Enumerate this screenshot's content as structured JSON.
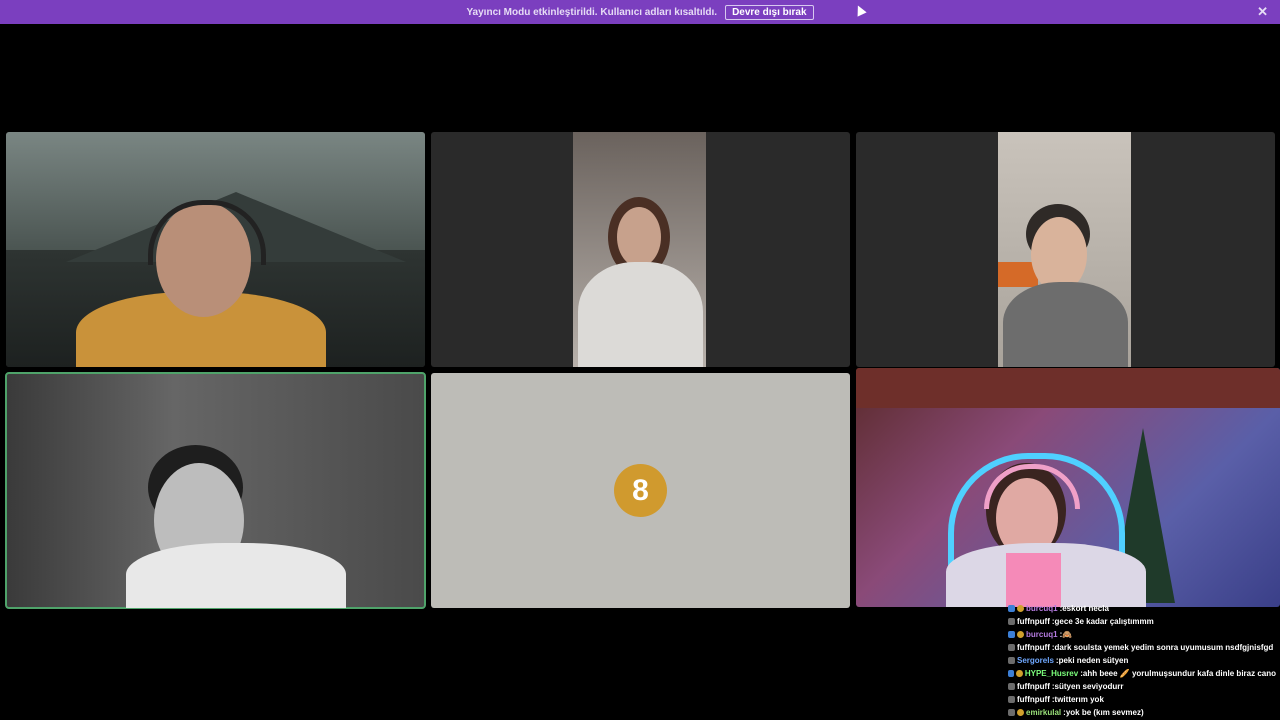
{
  "banner": {
    "text": "Yayıncı Modu etkinleştirildi. Kullanıcı adları kısaltıldı.",
    "button_label": "Devre dışı bırak",
    "close_icon": "close-icon"
  },
  "colors": {
    "banner": "#7b3fbf",
    "speaking_outline": "#4fa36a",
    "avatar_bg": "#d09a2e"
  },
  "tiles": [
    {
      "id": "participant-1",
      "type": "video"
    },
    {
      "id": "participant-2",
      "type": "video"
    },
    {
      "id": "participant-3",
      "type": "video"
    },
    {
      "id": "participant-4",
      "type": "video",
      "speaking": true
    },
    {
      "id": "participant-5",
      "type": "avatar",
      "avatar_text": "8"
    },
    {
      "id": "participant-6",
      "type": "video"
    }
  ],
  "chat": {
    "messages": [
      {
        "name": "burcuq1",
        "name_color": "#b57be0",
        "text": "eskort necla"
      },
      {
        "name": "fuffnpuff",
        "name_color": "#ffffff",
        "text": "gece 3e kadar çalıştımmm"
      },
      {
        "name": "burcuq1",
        "name_color": "#b57be0",
        "text": "🙈"
      },
      {
        "name": "fuffnpuff",
        "name_color": "#ffffff",
        "text": "dark soulsta yemek yedim sonra uyumusum nsdfgjnisfgd"
      },
      {
        "name": "Sergorels",
        "name_color": "#6fa8ff",
        "text": "peki neden sütyen"
      },
      {
        "name": "HYPE_Husrev",
        "name_color": "#7cff7c",
        "text": "ahh beee 🥖 yorulmuşsundur kafa dinle biraz cano"
      },
      {
        "name": "fuffnpuff",
        "name_color": "#ffffff",
        "text": "sütyen seviyodurr"
      },
      {
        "name": "fuffnpuff",
        "name_color": "#ffffff",
        "text": "twitterım yok"
      },
      {
        "name": "emirkulal",
        "name_color": "#9be27a",
        "text": "yok be (kım sevmez)"
      }
    ]
  }
}
